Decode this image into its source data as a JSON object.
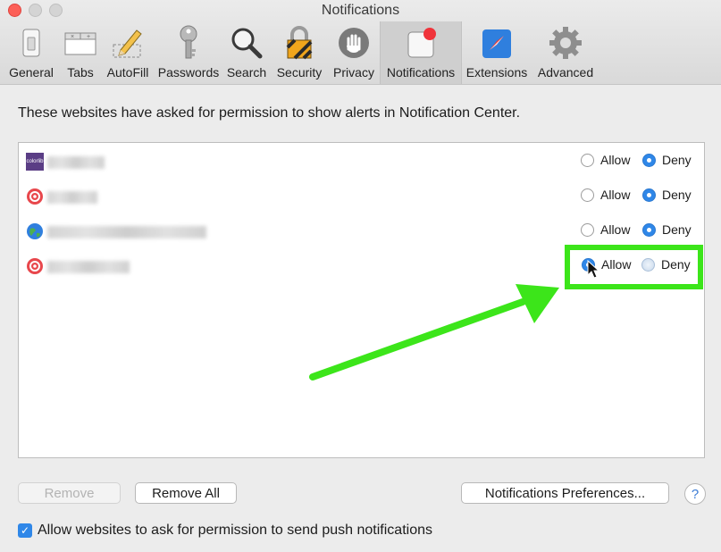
{
  "window": {
    "title": "Notifications"
  },
  "toolbar": {
    "items": [
      {
        "label": "General",
        "icon": "general-switch-icon"
      },
      {
        "label": "Tabs",
        "icon": "tabs-icon"
      },
      {
        "label": "AutoFill",
        "icon": "autofill-pencil-icon"
      },
      {
        "label": "Passwords",
        "icon": "key-icon"
      },
      {
        "label": "Search",
        "icon": "magnifier-icon"
      },
      {
        "label": "Security",
        "icon": "padlock-icon"
      },
      {
        "label": "Privacy",
        "icon": "hand-icon"
      },
      {
        "label": "Notifications",
        "icon": "notification-badge-icon",
        "active": true
      },
      {
        "label": "Extensions",
        "icon": "compass-icon"
      },
      {
        "label": "Advanced",
        "icon": "gear-icon"
      }
    ]
  },
  "intro": "These websites have asked for permission to show alerts in Notification Center.",
  "sites": [
    {
      "favicon": "colorlib-favicon",
      "favicon_text": "colorlib",
      "allow_label": "Allow",
      "deny_label": "Deny",
      "selected": "deny"
    },
    {
      "favicon": "opera-red-favicon",
      "allow_label": "Allow",
      "deny_label": "Deny",
      "selected": "deny"
    },
    {
      "favicon": "globe-favicon",
      "allow_label": "Allow",
      "deny_label": "Deny",
      "selected": "deny"
    },
    {
      "favicon": "opera-red-favicon",
      "allow_label": "Allow",
      "deny_label": "Deny",
      "selected": "allow"
    }
  ],
  "buttons": {
    "remove": "Remove",
    "remove_all": "Remove All",
    "preferences": "Notifications Preferences...",
    "help": "?"
  },
  "checkbox": {
    "label": "Allow websites to ask for permission to send push notifications",
    "checked": true,
    "mark": "✓"
  },
  "colors": {
    "accent": "#2f87e8",
    "highlight": "#3ce51a",
    "close": "#fc5f57"
  }
}
